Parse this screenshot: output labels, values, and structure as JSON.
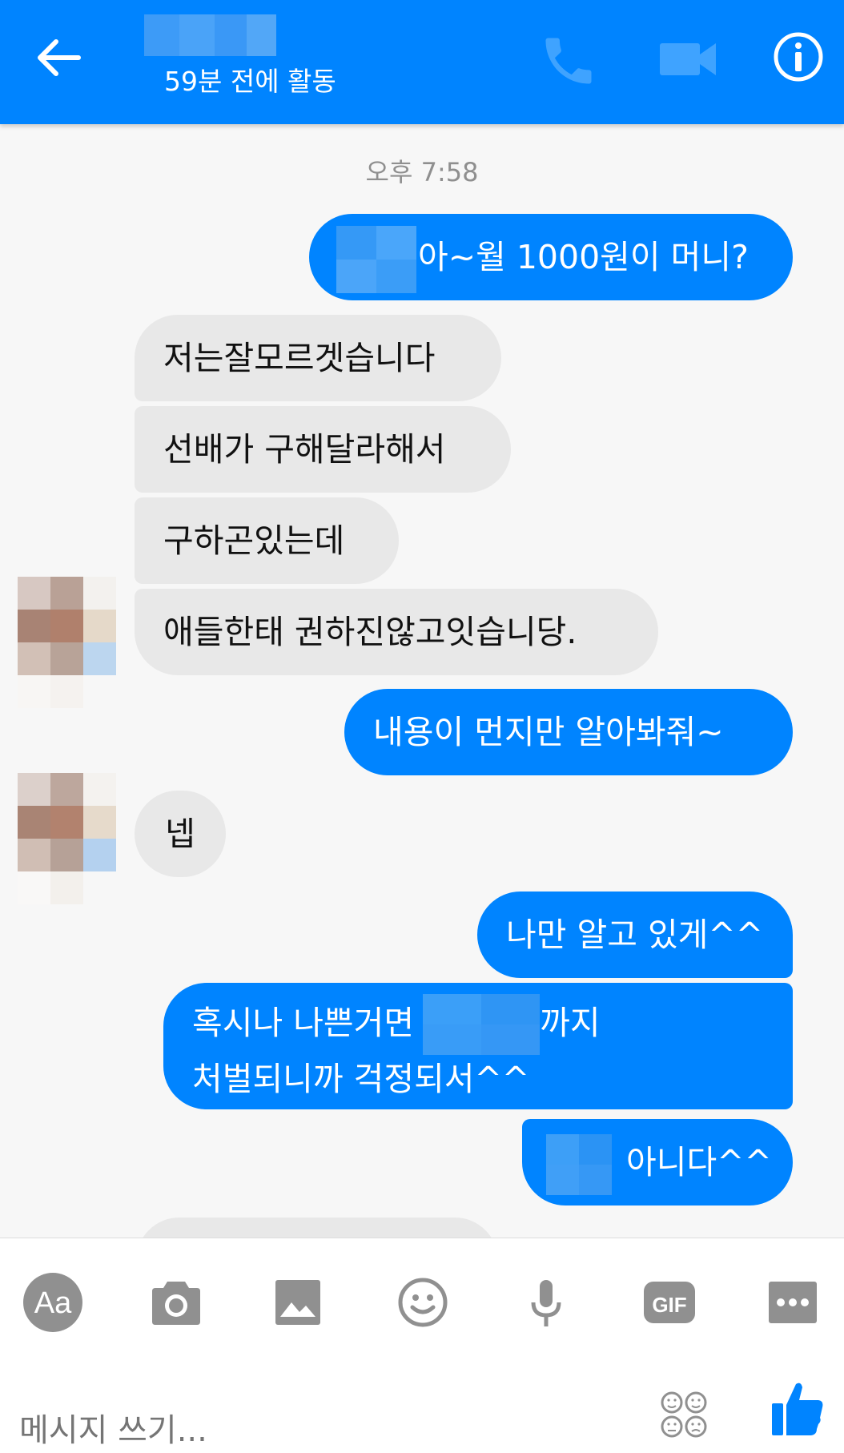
{
  "header": {
    "status": "59분 전에 활동",
    "back_icon": "arrow-left-icon",
    "call_icon": "phone-icon",
    "video_icon": "video-camera-icon",
    "info_icon": "info-circle-icon",
    "color": "#0084ff"
  },
  "chat": {
    "timestamp": "오후 7:58",
    "messages": [
      {
        "side": "out",
        "blurred_prefix": true,
        "text": "아~월 1000원이 머니?"
      },
      {
        "side": "in",
        "text": "저는잘모르겟습니다"
      },
      {
        "side": "in",
        "text": "선배가 구해달라해서"
      },
      {
        "side": "in",
        "text": "구하곤있는데"
      },
      {
        "side": "in",
        "text": "애들한태 권하진않고잇습니당."
      },
      {
        "side": "out",
        "text": "내용이 먼지만 알아봐줘~"
      },
      {
        "side": "in",
        "text": "넵"
      },
      {
        "side": "out",
        "text": "나만 알고 있게^^"
      },
      {
        "side": "out",
        "line1_a": "혹시나 나쁜거면",
        "line1_b": "까지",
        "line2": "처벌되니까 걱정되서^^"
      },
      {
        "side": "out",
        "blurred_prefix": true,
        "text": "아니다^^"
      }
    ]
  },
  "toolbar": {
    "text_icon_label": "Aa",
    "gif_label": "GIF",
    "placeholder": "메시지 쓰기...",
    "icons": [
      "text-style-icon",
      "camera-icon",
      "image-icon",
      "emoji-icon",
      "microphone-icon",
      "gif-icon",
      "more-icon"
    ],
    "stickers_icon": "stickers-icon",
    "like_icon": "thumbs-up-icon"
  },
  "colors": {
    "accent": "#0084ff",
    "incoming_bubble": "#e8e8e8",
    "toolbar_icon": "#909090"
  }
}
